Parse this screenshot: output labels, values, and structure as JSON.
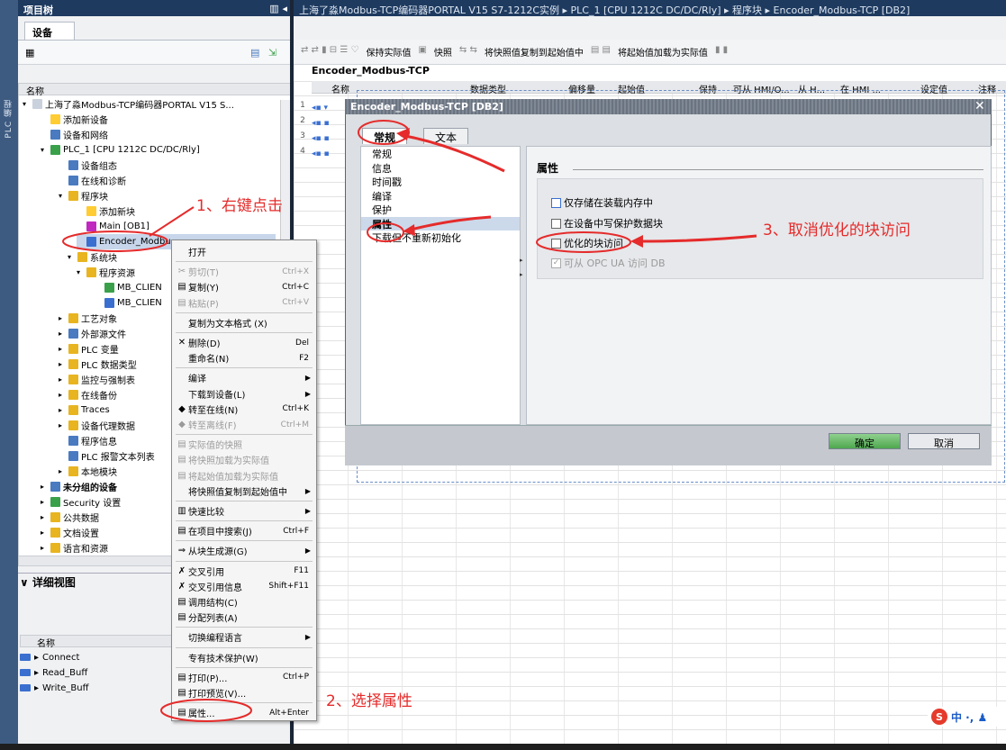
{
  "sidebar_vertical_label": "PLC 编程",
  "left_panel": {
    "title": "项目树",
    "tab": "设备",
    "column_header": "名称"
  },
  "tree": [
    {
      "label": "上海了淼Modbus-TCP编码器PORTAL V15 S...",
      "color": "#c9d1dc"
    },
    {
      "label": "添加新设备",
      "color": "#ffcc33"
    },
    {
      "label": "设备和网络",
      "color": "#4a7ac0"
    },
    {
      "label": "PLC_1 [CPU 1212C DC/DC/Rly]",
      "color": "#3aa04a"
    },
    {
      "label": "设备组态",
      "color": "#4a7ac0"
    },
    {
      "label": "在线和诊断",
      "color": "#4a7ac0"
    },
    {
      "label": "程序块",
      "color": "#e8b420"
    },
    {
      "label": "添加新块",
      "color": "#ffcc33"
    },
    {
      "label": "Main [OB1]",
      "color": "#c028c0"
    },
    {
      "label": "Encoder_Modbu",
      "color": "#3a6fd0"
    },
    {
      "label": "系统块",
      "color": "#e8b420"
    },
    {
      "label": "程序资源",
      "color": "#e8b420"
    },
    {
      "label": "MB_CLIEN",
      "color": "#3aa04a"
    },
    {
      "label": "MB_CLIEN",
      "color": "#3a6fd0"
    },
    {
      "label": "工艺对象",
      "color": "#e8b420"
    },
    {
      "label": "外部源文件",
      "color": "#4a7ac0"
    },
    {
      "label": "PLC 变量",
      "color": "#e8b420"
    },
    {
      "label": "PLC 数据类型",
      "color": "#e8b420"
    },
    {
      "label": "监控与强制表",
      "color": "#e8b420"
    },
    {
      "label": "在线备份",
      "color": "#e8b420"
    },
    {
      "label": "Traces",
      "color": "#e8b420"
    },
    {
      "label": "设备代理数据",
      "color": "#e8b420"
    },
    {
      "label": "程序信息",
      "color": "#4a7ac0"
    },
    {
      "label": "PLC 报警文本列表",
      "color": "#4a7ac0"
    },
    {
      "label": "本地模块",
      "color": "#e8b420"
    },
    {
      "label": "未分组的设备",
      "color": "#4a7ac0"
    },
    {
      "label": "Security 设置",
      "color": "#3aa04a"
    },
    {
      "label": "公共数据",
      "color": "#e8b420"
    },
    {
      "label": "文档设置",
      "color": "#e8b420"
    },
    {
      "label": "语言和资源",
      "color": "#e8b420"
    }
  ],
  "detail_view": {
    "title": "详细视图",
    "column_header": "名称",
    "items": [
      "Connect",
      "Read_Buff",
      "Write_Buff"
    ]
  },
  "breadcrumb": "上海了淼Modbus-TCP编码器PORTAL V15 S7-1212C实例 ▸ PLC_1 [CPU 1212C DC/DC/Rly] ▸ 程序块 ▸ Encoder_Modbus-TCP [DB2]",
  "toolbar": {
    "keep_actual": "保持实际值",
    "snapshot": "快照",
    "copy_snapshot": "将快照值复制到起始值中",
    "load_start": "将起始值加载为实际值"
  },
  "editor": {
    "block_title": "Encoder_Modbus-TCP",
    "columns": [
      "名称",
      "数据类型",
      "偏移量",
      "起始值",
      "保持",
      "可从 HMI/O...",
      "从 H...",
      "在 HMI ...",
      "设定值",
      "注释"
    ],
    "row_numbers": [
      "1",
      "2",
      "3",
      "4"
    ]
  },
  "dialog": {
    "title": "Encoder_Modbus-TCP [DB2]",
    "tabs": [
      "常规",
      "文本"
    ],
    "nav": [
      "常规",
      "信息",
      "时间戳",
      "编译",
      "保护",
      "属性",
      "下载但不重新初始化"
    ],
    "section_title": "属性",
    "checkboxes": [
      {
        "label": "仅存储在装载内存中",
        "checked": false
      },
      {
        "label": "在设备中写保护数据块",
        "checked": false
      },
      {
        "label": "优化的块访问",
        "checked": false
      },
      {
        "label": "可从 OPC UA 访问 DB",
        "checked": true,
        "disabled": true
      }
    ],
    "ok": "确定",
    "cancel": "取消"
  },
  "context_menu": [
    {
      "label": "打开",
      "shortcut": ""
    },
    {
      "label": "剪切(T)",
      "shortcut": "Ctrl+X",
      "disabled": true
    },
    {
      "label": "复制(Y)",
      "shortcut": "Ctrl+C"
    },
    {
      "label": "粘贴(P)",
      "shortcut": "Ctrl+V",
      "disabled": true
    },
    {
      "label": "复制为文本格式 (X)",
      "shortcut": ""
    },
    {
      "label": "删除(D)",
      "shortcut": "Del"
    },
    {
      "label": "重命名(N)",
      "shortcut": "F2"
    },
    {
      "label": "编译",
      "shortcut": ""
    },
    {
      "label": "下载到设备(L)",
      "shortcut": ""
    },
    {
      "label": "转至在线(N)",
      "shortcut": "Ctrl+K"
    },
    {
      "label": "转至离线(F)",
      "shortcut": "Ctrl+M",
      "disabled": true
    },
    {
      "label": "实际值的快照",
      "shortcut": "",
      "disabled": true
    },
    {
      "label": "将快照加载为实际值",
      "shortcut": "",
      "disabled": true
    },
    {
      "label": "将起始值加载为实际值",
      "shortcut": "",
      "disabled": true
    },
    {
      "label": "将快照值复制到起始值中",
      "shortcut": ""
    },
    {
      "label": "快速比较",
      "shortcut": ""
    },
    {
      "label": "在项目中搜索(J)",
      "shortcut": "Ctrl+F"
    },
    {
      "label": "从块生成源(G)",
      "shortcut": ""
    },
    {
      "label": "交叉引用",
      "shortcut": "F11"
    },
    {
      "label": "交叉引用信息",
      "shortcut": "Shift+F11"
    },
    {
      "label": "调用结构(C)",
      "shortcut": ""
    },
    {
      "label": "分配列表(A)",
      "shortcut": ""
    },
    {
      "label": "切换编程语言",
      "shortcut": ""
    },
    {
      "label": "专有技术保护(W)",
      "shortcut": ""
    },
    {
      "label": "打印(P)...",
      "shortcut": "Ctrl+P"
    },
    {
      "label": "打印预览(V)...",
      "shortcut": ""
    },
    {
      "label": "属性...",
      "shortcut": "Alt+Enter"
    }
  ],
  "annotations": {
    "step1": "1、右键点击",
    "step2": "2、选择属性",
    "step3": "3、取消优化的块访问"
  },
  "ime": {
    "logo": "S",
    "text": "中 ·, ♟"
  },
  "colors": {
    "annotation": "#e52b2b",
    "title_bar": "#1e3a5f",
    "selection": "#c7d6ea"
  }
}
